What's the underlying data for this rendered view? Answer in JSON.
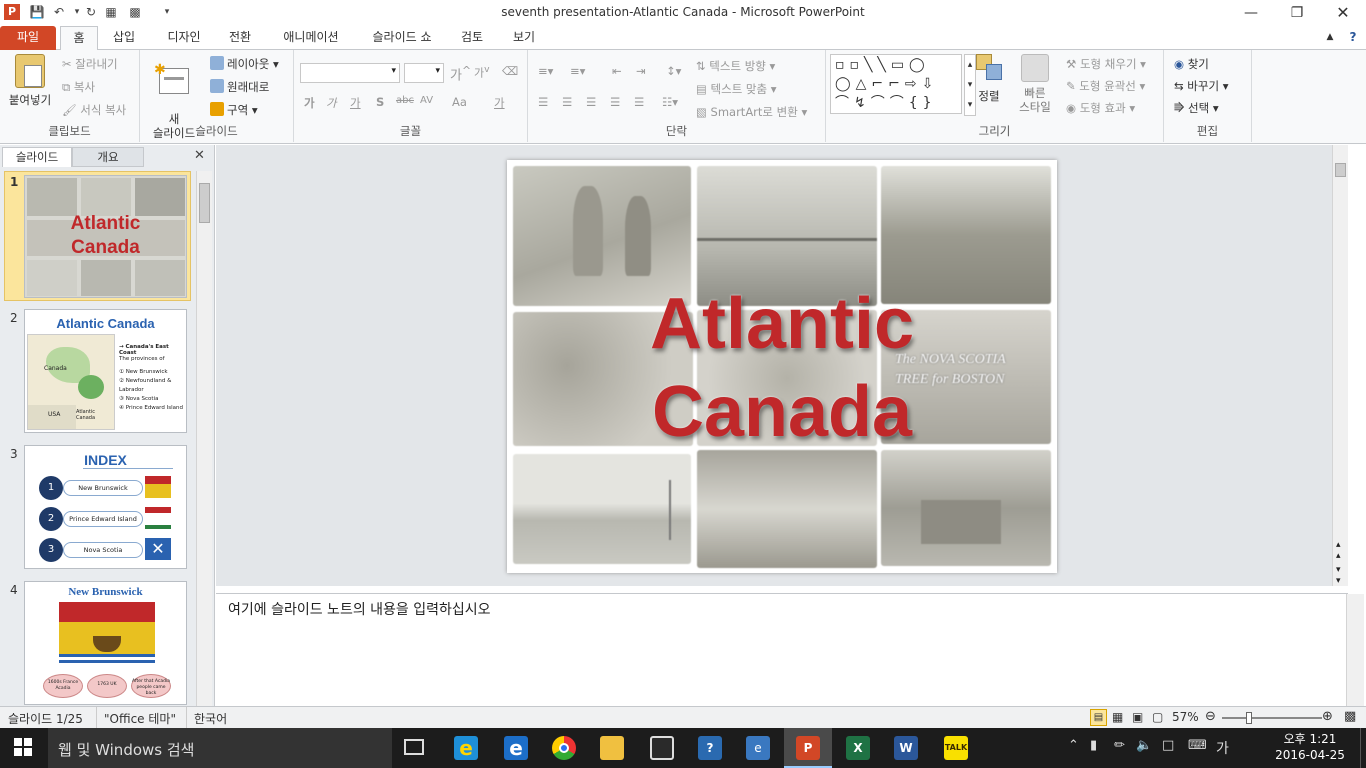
{
  "window": {
    "title": "seventh presentation-Atlantic Canada  -  Microsoft PowerPoint"
  },
  "tabs": [
    "파일",
    "홈",
    "삽입",
    "디자인",
    "전환",
    "애니메이션",
    "슬라이드 쇼",
    "검토",
    "보기"
  ],
  "ribbon": {
    "clipboard": {
      "label": "클립보드",
      "paste": "붙여넣기",
      "cut": "잘라내기",
      "copy": "복사",
      "format_painter": "서식 복사"
    },
    "slides": {
      "label": "슬라이드",
      "new_slide": "새\n슬라이드",
      "layout": "레이아웃",
      "reset": "원래대로",
      "section": "구역"
    },
    "font": {
      "label": "글꼴",
      "bold": "가",
      "italic": "가",
      "underline": "가",
      "shadow": "S",
      "strike": "abc",
      "spacing": "AV",
      "case": "Aa",
      "color": "가"
    },
    "paragraph": {
      "label": "단락",
      "text_direction": "텍스트 방향",
      "align_text": "텍스트 맞춤",
      "smartart": "SmartArt로 변환"
    },
    "drawing": {
      "label": "그리기",
      "arrange": "정렬",
      "quick_styles": "빠른\n스타일",
      "shape_fill": "도형 채우기",
      "shape_outline": "도형 윤곽선",
      "shape_effects": "도형 효과"
    },
    "editing": {
      "label": "편집",
      "find": "찾기",
      "replace": "바꾸기",
      "select": "선택"
    }
  },
  "pane_tabs": {
    "slides": "슬라이드",
    "outline": "개요"
  },
  "thumbnails": [
    {
      "num": "1",
      "title_line1": "Atlantic",
      "title_line2": "Canada"
    },
    {
      "num": "2",
      "title": "Atlantic Canada",
      "heading": "→ Canada's East Coast",
      "intro": "The provinces of",
      "items": [
        "New Brunswick",
        "Newfoundland & Labrador",
        "Nova Scotia",
        "Prince Edward Island"
      ],
      "map_labels": [
        "Canada",
        "USA",
        "Atlantic Canada"
      ]
    },
    {
      "num": "3",
      "title": "INDEX",
      "items": [
        {
          "n": "1",
          "label": "New Brunswick"
        },
        {
          "n": "2",
          "label": "Prince Edward Island"
        },
        {
          "n": "3",
          "label": "Nova Scotia"
        }
      ]
    },
    {
      "num": "4",
      "title": "New Brunswick",
      "bubbles": [
        "1600s France Acadia",
        "1763 UK",
        "After that Acadia people came back"
      ]
    }
  ],
  "slide": {
    "title_line1": "Atlantic",
    "title_line2": "Canada",
    "sign_text": [
      "The",
      "NOVA SCOTIA",
      "TREE",
      "BOSTON"
    ]
  },
  "notes": {
    "placeholder": "여기에 슬라이드 노트의 내용을 입력하십시오"
  },
  "status": {
    "slide": "슬라이드 1/25",
    "theme": "\"Office 테마\"",
    "language": "한국어",
    "zoom": "57%"
  },
  "taskbar": {
    "search": "웹 및 Windows 검색",
    "ampm_time": "오후 1:21",
    "date": "2016-04-25",
    "ime": "가"
  },
  "colors": {
    "file_tab": "#d24726",
    "title_red": "#c0282a",
    "status_blue": "#2b579a"
  }
}
